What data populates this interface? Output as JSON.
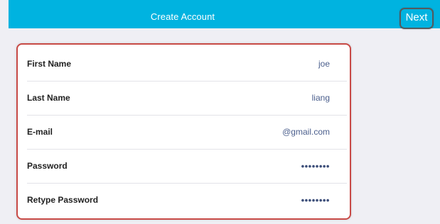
{
  "header": {
    "title": "Create Account",
    "next_label": "Next"
  },
  "form": {
    "fields": [
      {
        "label": "First Name",
        "value": "joe"
      },
      {
        "label": "Last Name",
        "value": "liang"
      },
      {
        "label": "E-mail",
        "value": "@gmail.com"
      },
      {
        "label": "Password",
        "value": "••••••••"
      },
      {
        "label": "Retype Password",
        "value": "••••••••"
      }
    ]
  },
  "colors": {
    "navbar": "#00b3e0",
    "background": "#efeff4",
    "value_text": "#4a5e8c",
    "highlight_border": "#c84a46"
  }
}
